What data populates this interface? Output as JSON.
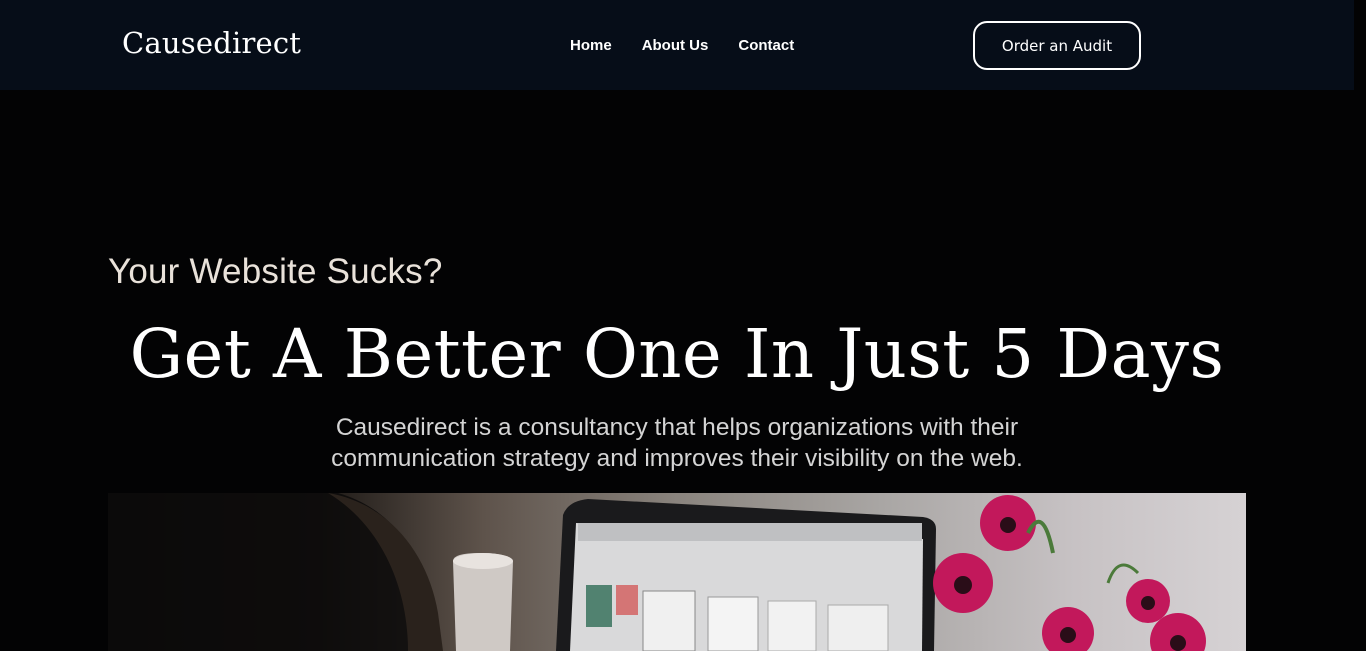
{
  "header": {
    "logo": "Causedirect",
    "nav": [
      "Home",
      "About Us",
      "Contact"
    ],
    "cta_label": "Order an Audit"
  },
  "hero": {
    "kicker": "Your Website Sucks?",
    "headline": "Get A Better One In Just 5 Days",
    "subtitle_line1": "Causedirect is a consultancy that helps organizations with their",
    "subtitle_line2": "communication strategy and improves their visibility on the web."
  },
  "colors": {
    "header_bg": "#060d18",
    "page_bg": "#030304",
    "text": "#ffffff"
  }
}
